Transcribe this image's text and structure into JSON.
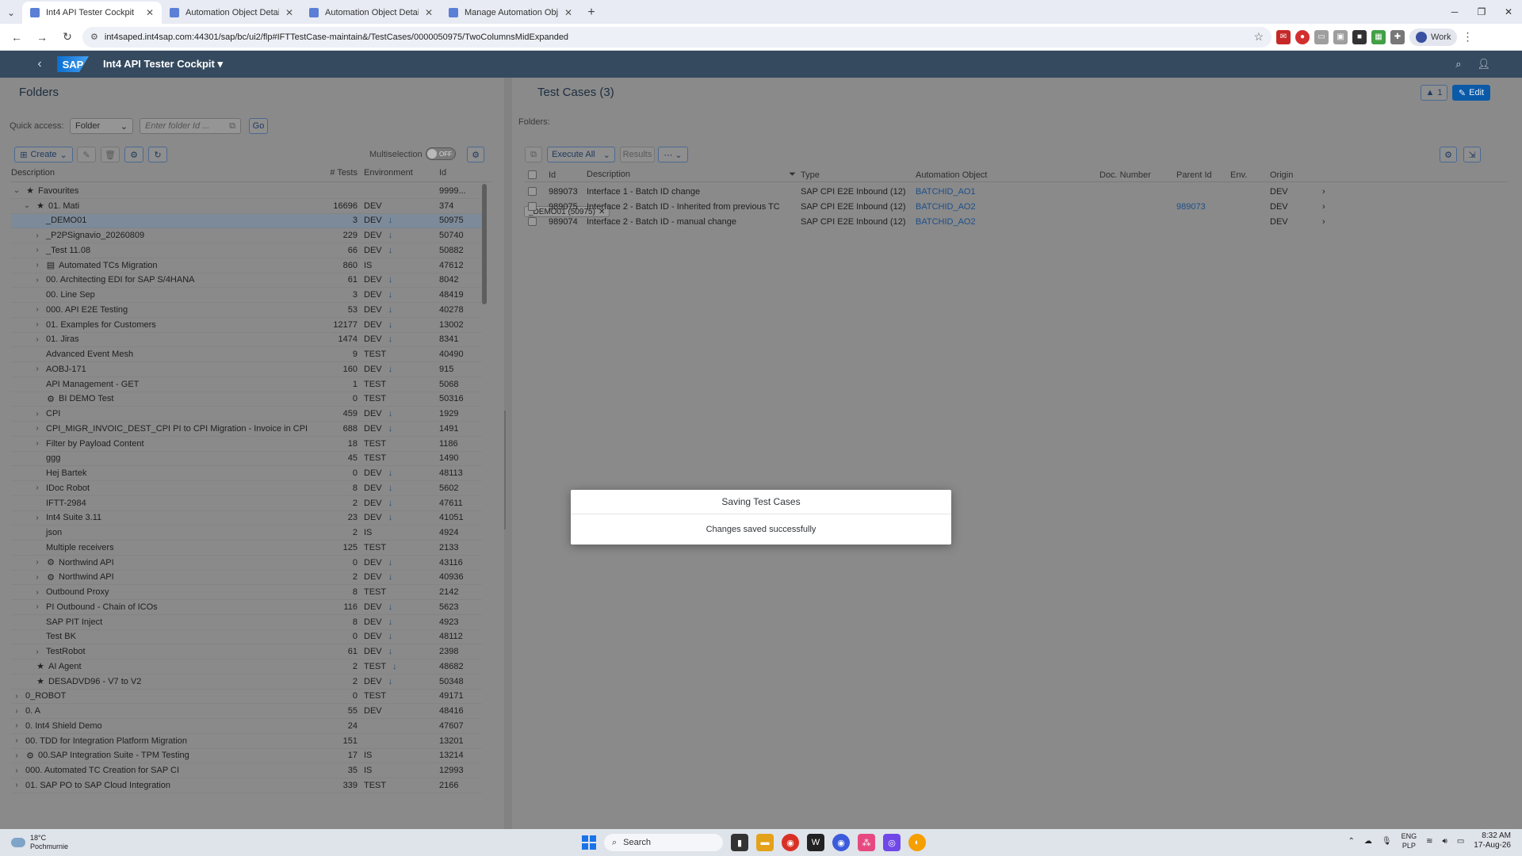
{
  "browser": {
    "tabs": [
      {
        "label": "Int4 API Tester Cockpit",
        "active": true
      },
      {
        "label": "Automation Object Details",
        "active": false
      },
      {
        "label": "Automation Object Details",
        "active": false
      },
      {
        "label": "Manage Automation Objects",
        "active": false
      }
    ],
    "url": "int4saped.int4sap.com:44301/sap/bc/ui2/flp#IFTTestCase-maintain&/TestCases/0000050975/TwoColumnsMidExpanded",
    "profile_label": "Work"
  },
  "shell": {
    "logo": "SAP",
    "app_title": "Int4 API Tester Cockpit ▾"
  },
  "folders_panel": {
    "title": "Folders",
    "quick_access_label": "Quick access:",
    "folder_select_value": "Folder",
    "folder_id_placeholder": "Enter folder Id ...",
    "go_label": "Go",
    "create_label": "Create",
    "multiselection_label": "Multiselection",
    "toggle_state": "OFF",
    "columns": {
      "description": "Description",
      "tests": "# Tests",
      "environment": "Environment",
      "id": "Id"
    },
    "rows": [
      {
        "desc": "Favourites",
        "tests": "",
        "env": "",
        "id": "9999...",
        "level": 0,
        "exp": "down",
        "icon": "★",
        "down": false
      },
      {
        "desc": "01. Mati",
        "tests": "16696",
        "env": "DEV",
        "id": "374",
        "level": 1,
        "exp": "down",
        "icon": "★",
        "down": false
      },
      {
        "desc": "_DEMO01",
        "tests": "3",
        "env": "DEV",
        "id": "50975",
        "level": 2,
        "exp": "",
        "icon": "",
        "down": true,
        "selected": true
      },
      {
        "desc": "_P2PSignavio_20260809",
        "tests": "229",
        "env": "DEV",
        "id": "50740",
        "level": 2,
        "exp": "right",
        "icon": "",
        "down": true
      },
      {
        "desc": "_Test 11.08",
        "tests": "66",
        "env": "DEV",
        "id": "50882",
        "level": 2,
        "exp": "right",
        "icon": "",
        "down": true
      },
      {
        "desc": "Automated TCs Migration",
        "tests": "860",
        "env": "IS",
        "id": "47612",
        "level": 2,
        "exp": "right",
        "icon": "▤",
        "down": false
      },
      {
        "desc": "00. Architecting EDI for SAP S/4HANA",
        "tests": "61",
        "env": "DEV",
        "id": "8042",
        "level": 2,
        "exp": "right",
        "icon": "",
        "down": true
      },
      {
        "desc": "00. Line Sep",
        "tests": "3",
        "env": "DEV",
        "id": "48419",
        "level": 2,
        "exp": "",
        "icon": "",
        "down": true
      },
      {
        "desc": "000. API E2E Testing",
        "tests": "53",
        "env": "DEV",
        "id": "40278",
        "level": 2,
        "exp": "right",
        "icon": "",
        "down": true
      },
      {
        "desc": "01. Examples for Customers",
        "tests": "12177",
        "env": "DEV",
        "id": "13002",
        "level": 2,
        "exp": "right",
        "icon": "",
        "down": true
      },
      {
        "desc": "01. Jiras",
        "tests": "1474",
        "env": "DEV",
        "id": "8341",
        "level": 2,
        "exp": "right",
        "icon": "",
        "down": true
      },
      {
        "desc": "Advanced Event Mesh",
        "tests": "9",
        "env": "TEST",
        "id": "40490",
        "level": 2,
        "exp": "",
        "icon": "",
        "down": false
      },
      {
        "desc": "AOBJ-171",
        "tests": "160",
        "env": "DEV",
        "id": "915",
        "level": 2,
        "exp": "right",
        "icon": "",
        "down": true
      },
      {
        "desc": "API Management - GET",
        "tests": "1",
        "env": "TEST",
        "id": "5068",
        "level": 2,
        "exp": "",
        "icon": "",
        "down": false
      },
      {
        "desc": "BI DEMO Test",
        "tests": "0",
        "env": "TEST",
        "id": "50316",
        "level": 2,
        "exp": "",
        "icon": "⚙",
        "down": false
      },
      {
        "desc": "CPI",
        "tests": "459",
        "env": "DEV",
        "id": "1929",
        "level": 2,
        "exp": "right",
        "icon": "",
        "down": true
      },
      {
        "desc": "CPI_MIGR_INVOIC_DEST_CPI PI to CPI Migration - Invoice in CPI",
        "tests": "688",
        "env": "DEV",
        "id": "1491",
        "level": 2,
        "exp": "right",
        "icon": "",
        "down": true
      },
      {
        "desc": "Filter by Payload Content",
        "tests": "18",
        "env": "TEST",
        "id": "1186",
        "level": 2,
        "exp": "right",
        "icon": "",
        "down": false
      },
      {
        "desc": "ggg",
        "tests": "45",
        "env": "TEST",
        "id": "1490",
        "level": 2,
        "exp": "",
        "icon": "",
        "down": false
      },
      {
        "desc": "Hej Bartek",
        "tests": "0",
        "env": "DEV",
        "id": "48113",
        "level": 2,
        "exp": "",
        "icon": "",
        "down": true
      },
      {
        "desc": "IDoc Robot",
        "tests": "8",
        "env": "DEV",
        "id": "5602",
        "level": 2,
        "exp": "right",
        "icon": "",
        "down": true
      },
      {
        "desc": "IFTT-2984",
        "tests": "2",
        "env": "DEV",
        "id": "47611",
        "level": 2,
        "exp": "",
        "icon": "",
        "down": true
      },
      {
        "desc": "Int4 Suite 3.11",
        "tests": "23",
        "env": "DEV",
        "id": "41051",
        "level": 2,
        "exp": "right",
        "icon": "",
        "down": true
      },
      {
        "desc": "json",
        "tests": "2",
        "env": "IS",
        "id": "4924",
        "level": 2,
        "exp": "",
        "icon": "",
        "down": false
      },
      {
        "desc": "Multiple receivers",
        "tests": "125",
        "env": "TEST",
        "id": "2133",
        "level": 2,
        "exp": "",
        "icon": "",
        "down": false
      },
      {
        "desc": "Northwind API",
        "tests": "0",
        "env": "DEV",
        "id": "43116",
        "level": 2,
        "exp": "right",
        "icon": "⚙",
        "down": true
      },
      {
        "desc": "Northwind API",
        "tests": "2",
        "env": "DEV",
        "id": "40936",
        "level": 2,
        "exp": "right",
        "icon": "⚙",
        "down": true
      },
      {
        "desc": "Outbound Proxy",
        "tests": "8",
        "env": "TEST",
        "id": "2142",
        "level": 2,
        "exp": "right",
        "icon": "",
        "down": false
      },
      {
        "desc": "PI Outbound - Chain of ICOs",
        "tests": "116",
        "env": "DEV",
        "id": "5623",
        "level": 2,
        "exp": "right",
        "icon": "",
        "down": true
      },
      {
        "desc": "SAP PIT Inject",
        "tests": "8",
        "env": "DEV",
        "id": "4923",
        "level": 2,
        "exp": "",
        "icon": "",
        "down": true
      },
      {
        "desc": "Test BK",
        "tests": "0",
        "env": "DEV",
        "id": "48112",
        "level": 2,
        "exp": "",
        "icon": "",
        "down": true
      },
      {
        "desc": "TestRobot",
        "tests": "61",
        "env": "DEV",
        "id": "2398",
        "level": 2,
        "exp": "right",
        "icon": "",
        "down": true
      },
      {
        "desc": "AI Agent",
        "tests": "2",
        "env": "TEST",
        "id": "48682",
        "level": 1,
        "exp": "",
        "icon": "★",
        "down": true
      },
      {
        "desc": "DESADVD96 - V7 to V2",
        "tests": "2",
        "env": "DEV",
        "id": "50348",
        "level": 1,
        "exp": "",
        "icon": "★",
        "down": true
      },
      {
        "desc": "0_ROBOT",
        "tests": "0",
        "env": "TEST",
        "id": "49171",
        "level": 0,
        "exp": "right",
        "icon": "",
        "down": false
      },
      {
        "desc": "0. A",
        "tests": "55",
        "env": "DEV",
        "id": "48416",
        "level": 0,
        "exp": "right",
        "icon": "",
        "down": false
      },
      {
        "desc": "0. Int4 Shield Demo",
        "tests": "24",
        "env": "",
        "id": "47607",
        "level": 0,
        "exp": "right",
        "icon": "",
        "down": false
      },
      {
        "desc": "00. TDD for Integration Platform Migration",
        "tests": "151",
        "env": "",
        "id": "13201",
        "level": 0,
        "exp": "right",
        "icon": "",
        "down": false
      },
      {
        "desc": "00.SAP Integration Suite - TPM Testing",
        "tests": "17",
        "env": "IS",
        "id": "13214",
        "level": 0,
        "exp": "right",
        "icon": "⚙",
        "down": false
      },
      {
        "desc": "000. Automated TC Creation for SAP CI",
        "tests": "35",
        "env": "IS",
        "id": "12993",
        "level": 0,
        "exp": "right",
        "icon": "",
        "down": false
      },
      {
        "desc": "01. SAP PO to SAP Cloud Integration",
        "tests": "339",
        "env": "TEST",
        "id": "2166",
        "level": 0,
        "exp": "right",
        "icon": "",
        "down": false
      }
    ]
  },
  "testcases_panel": {
    "title": "Test Cases (3)",
    "alert_count": "1",
    "edit_label": "Edit",
    "folders_label": "Folders:",
    "folder_token": "_DEMO01 (50975)",
    "execute_label": "Execute All",
    "results_label": "Results",
    "columns": {
      "id": "Id",
      "description": "Description",
      "type": "Type",
      "automation_object": "Automation Object",
      "doc_number": "Doc. Number",
      "parent_id": "Parent Id",
      "env": "Env.",
      "origin": "Origin"
    },
    "rows": [
      {
        "id": "989073",
        "description": "Interface 1 - Batch ID change",
        "type": "SAP CPI E2E Inbound (12)",
        "ao": "BATCHID_AO1",
        "doc": "",
        "parent": "",
        "env": "",
        "origin": "DEV"
      },
      {
        "id": "989075",
        "description": "Interface 2 - Batch ID - Inherited from previous TC",
        "type": "SAP CPI E2E Inbound (12)",
        "ao": "BATCHID_AO2",
        "doc": "",
        "parent": "989073",
        "env": "",
        "origin": "DEV"
      },
      {
        "id": "989074",
        "description": "Interface 2 - Batch ID - manual change",
        "type": "SAP CPI E2E Inbound (12)",
        "ao": "BATCHID_AO2",
        "doc": "",
        "parent": "",
        "env": "",
        "origin": "DEV"
      }
    ]
  },
  "dialog": {
    "title": "Saving Test Cases",
    "message": "Changes saved successfully"
  },
  "taskbar": {
    "temperature": "18°C",
    "weather_location": "Pochmurnie",
    "search_label": "Search",
    "lang_top": "ENG",
    "lang_bottom": "PLP",
    "time": "8:32 AM",
    "date": "17-Aug-26"
  }
}
